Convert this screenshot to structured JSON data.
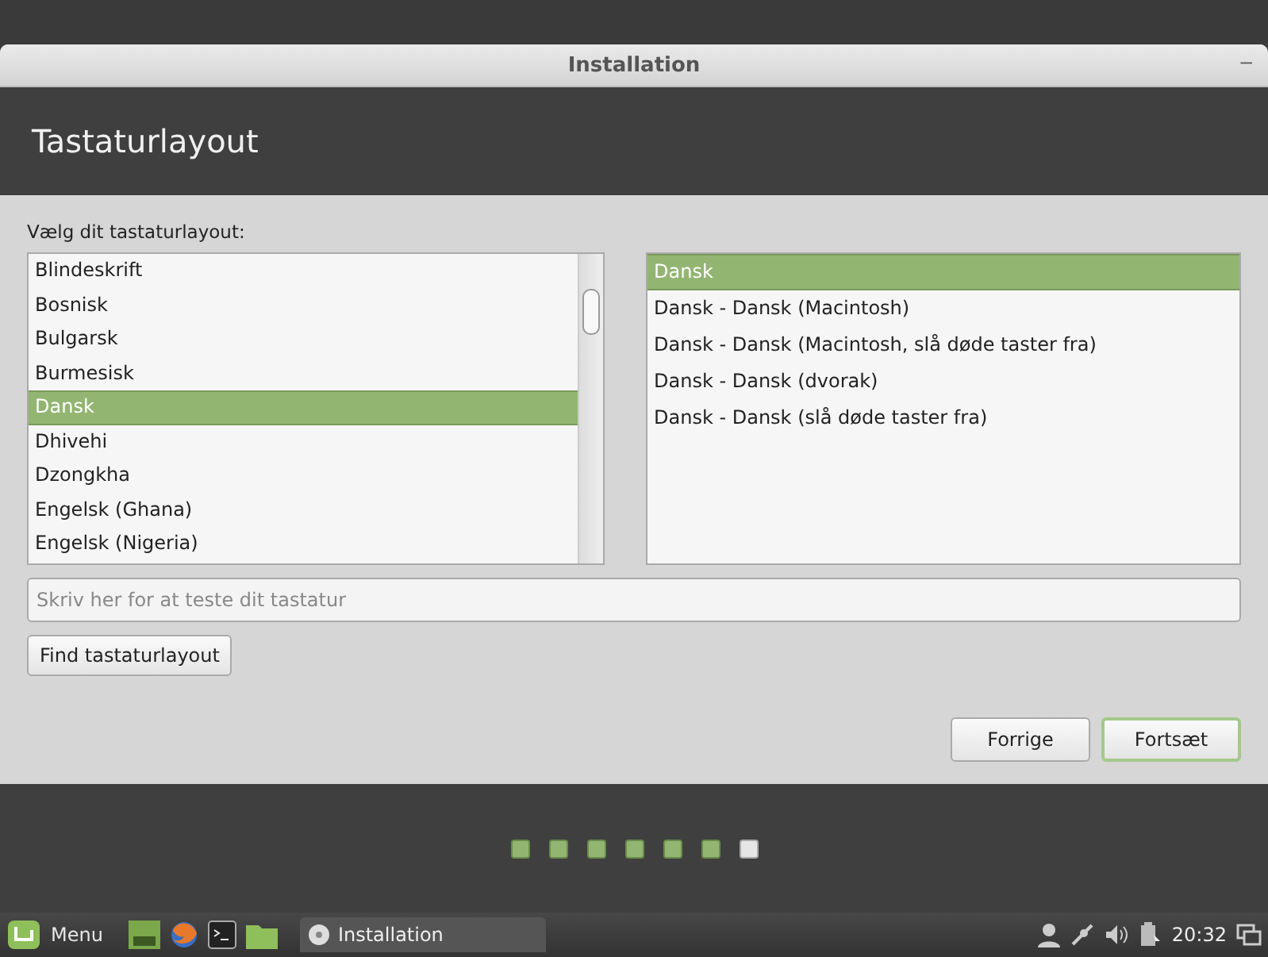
{
  "window": {
    "title": "Installation",
    "minimize": "–"
  },
  "header": {
    "title": "Tastaturlayout"
  },
  "prompt": "Vælg dit tastaturlayout:",
  "languages": [
    {
      "label": "Blindeskrift",
      "selected": false
    },
    {
      "label": "Bosnisk",
      "selected": false
    },
    {
      "label": "Bulgarsk",
      "selected": false
    },
    {
      "label": "Burmesisk",
      "selected": false
    },
    {
      "label": "Dansk",
      "selected": true
    },
    {
      "label": "Dhivehi",
      "selected": false
    },
    {
      "label": "Dzongkha",
      "selected": false
    },
    {
      "label": "Engelsk (Ghana)",
      "selected": false
    },
    {
      "label": "Engelsk (Nigeria)",
      "selected": false
    }
  ],
  "variants": [
    {
      "label": "Dansk",
      "selected": true
    },
    {
      "label": "Dansk - Dansk (Macintosh)",
      "selected": false
    },
    {
      "label": "Dansk - Dansk (Macintosh, slå døde taster fra)",
      "selected": false
    },
    {
      "label": "Dansk - Dansk (dvorak)",
      "selected": false
    },
    {
      "label": "Dansk - Dansk (slå døde taster fra)",
      "selected": false
    }
  ],
  "test_field": {
    "placeholder": "Skriv her for at teste dit tastatur"
  },
  "detect_button": "Find tastaturlayout",
  "buttons": [
    {
      "label": "Forrige",
      "default": false
    },
    {
      "label": "Fortsæt",
      "default": true
    }
  ],
  "steps": [
    {
      "selected": false
    },
    {
      "selected": false
    },
    {
      "selected": false
    },
    {
      "selected": false
    },
    {
      "selected": false
    },
    {
      "selected": false
    },
    {
      "selected": true
    }
  ],
  "taskbar": {
    "menu": "Menu",
    "task": "Installation",
    "clock": "20:32"
  }
}
